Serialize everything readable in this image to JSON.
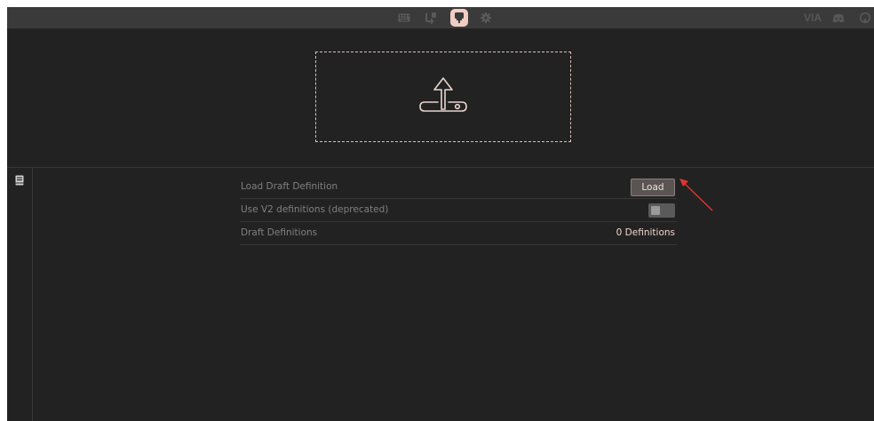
{
  "nav": {
    "icons": [
      "keyboard-icon",
      "keymap-icon",
      "design-icon",
      "settings-icon"
    ],
    "active": "design-icon",
    "right_links": {
      "via_logo": "VIA",
      "discord": "discord-icon",
      "github": "github-icon"
    }
  },
  "dropzone": {
    "icon": "upload-icon"
  },
  "sidebar": {
    "icon": "book-icon"
  },
  "settings": {
    "load_draft": {
      "label": "Load Draft Definition",
      "button": "Load"
    },
    "use_v2": {
      "label": "Use V2 definitions (deprecated)",
      "enabled": false
    },
    "draft_definitions": {
      "label": "Draft Definitions",
      "count": "0 Definitions"
    }
  },
  "colors": {
    "accent": "#f0cdc4",
    "background": "#222222",
    "topbar": "#3a3a3a",
    "annotation": "#e3342f"
  }
}
